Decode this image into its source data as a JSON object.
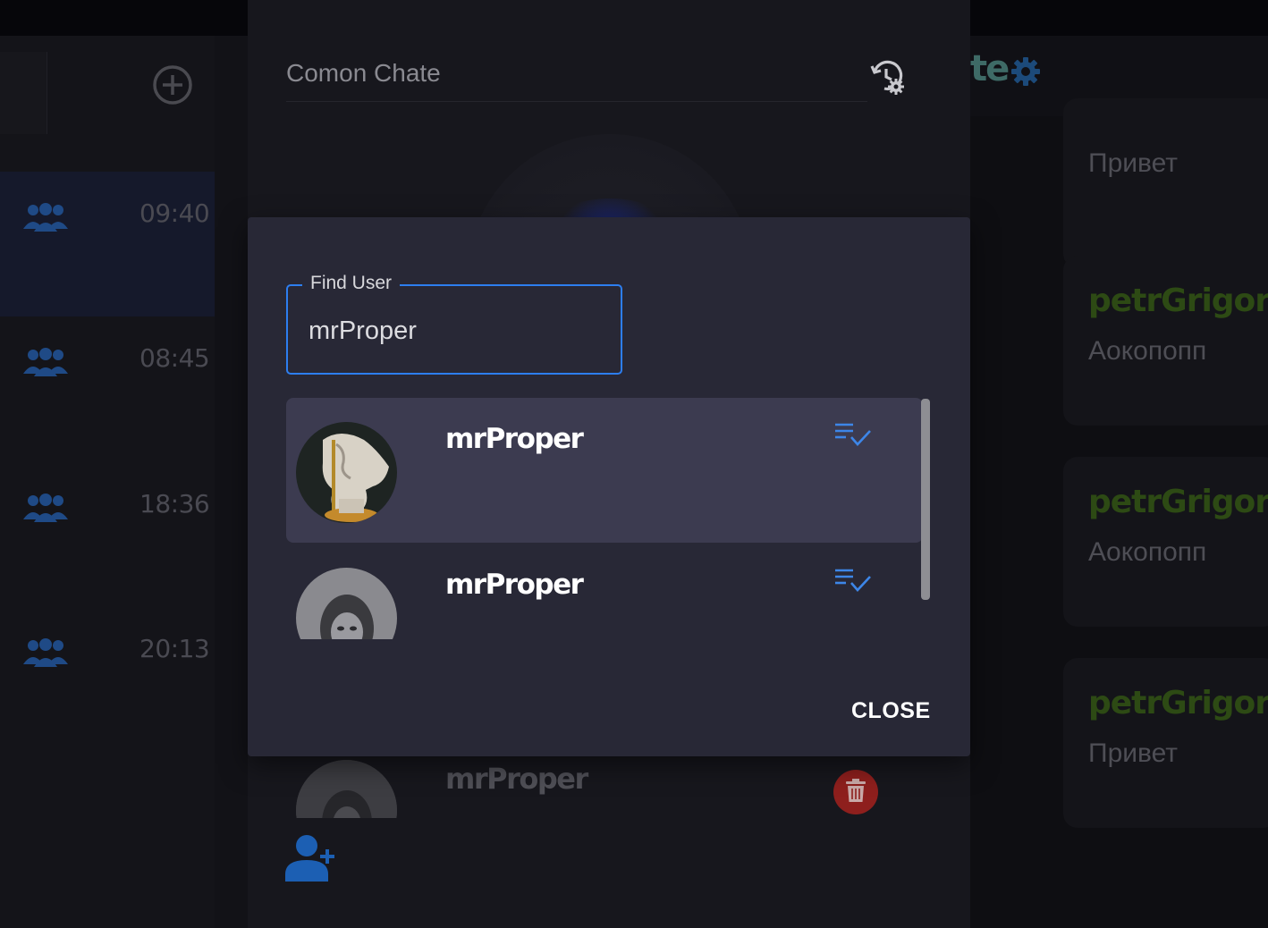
{
  "sidebar": {
    "chats": [
      {
        "time": "09:40",
        "active": true
      },
      {
        "time": "08:45"
      },
      {
        "time": "18:36"
      },
      {
        "time": "20:13"
      }
    ]
  },
  "header": {
    "title_fragment": "te"
  },
  "messages": [
    {
      "author": "",
      "text": "Привет"
    },
    {
      "author": "petrGrigoret",
      "text": "Аокопопп"
    },
    {
      "author": "petrGrigoret",
      "text": "Аокопопп"
    },
    {
      "author": "petrGrigoret",
      "text": "Привет"
    }
  ],
  "center": {
    "chat_title": "Comon Chate",
    "member_name": "mrProper"
  },
  "dialog": {
    "field_label": "Find User",
    "field_value": "mrProper",
    "results": [
      {
        "name": "mrProper"
      },
      {
        "name": "mrProper"
      }
    ],
    "close_label": "CLOSE"
  },
  "colors": {
    "accent": "#2d7ef0",
    "dialog_bg": "#282836",
    "highlight": "#3c3b50",
    "danger": "#8e1f1d"
  }
}
